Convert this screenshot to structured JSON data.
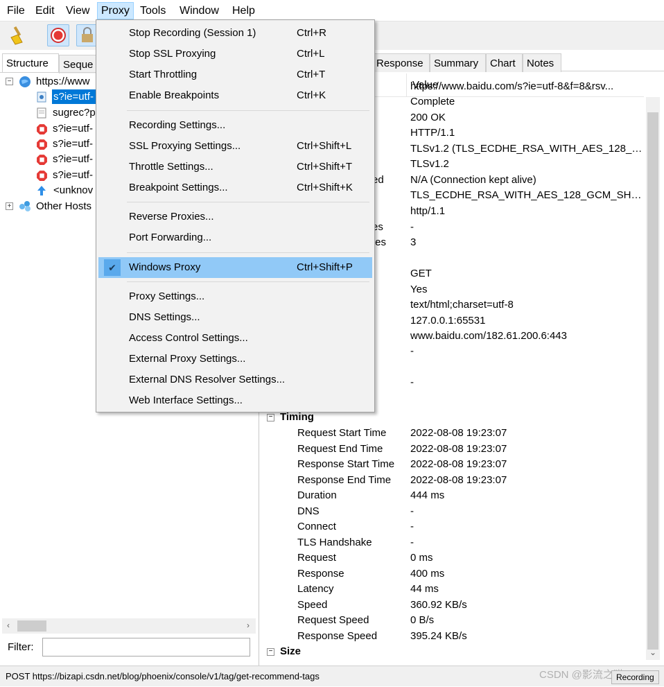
{
  "menubar": {
    "items": [
      "File",
      "Edit",
      "View",
      "Proxy",
      "Tools",
      "Window",
      "Help"
    ]
  },
  "left_tabs": [
    "Structure",
    "Seque"
  ],
  "tree": {
    "host": "https://www",
    "children": [
      "s?ie=utf-",
      "sugrec?p",
      "s?ie=utf-",
      "s?ie=utf-",
      "s?ie=utf-",
      "s?ie=utf-",
      "<unknov"
    ],
    "other_hosts": "Other Hosts"
  },
  "filter": {
    "label": "Filter:",
    "value": ""
  },
  "right_tabs": [
    "Response",
    "Summary",
    "Chart",
    "Notes"
  ],
  "column_header": "Value",
  "overview_rows": [
    {
      "key": "",
      "value": "https://www.baidu.com/s?ie=utf-8&f=8&rsv..."
    },
    {
      "key": "",
      "value": "Complete"
    },
    {
      "key": "",
      "value": "200 OK"
    },
    {
      "key": "",
      "value": "HTTP/1.1"
    },
    {
      "key": "",
      "value": "TLSv1.2 (TLS_ECDHE_RSA_WITH_AES_128_G..."
    },
    {
      "key": "",
      "value": "TLSv1.2"
    },
    {
      "key": "ed",
      "value": "N/A (Connection kept alive)"
    },
    {
      "key": "",
      "value": "TLS_ECDHE_RSA_WITH_AES_128_GCM_SHA..."
    },
    {
      "key": "",
      "value": "http/1.1"
    },
    {
      "key": "es",
      "value": "-"
    },
    {
      "key": "tes",
      "value": "3"
    },
    {
      "key": "",
      "value": ""
    },
    {
      "key": "",
      "value": "GET"
    },
    {
      "key": "",
      "value": "Yes"
    },
    {
      "key": "",
      "value": "text/html;charset=utf-8"
    },
    {
      "key": "",
      "value": "127.0.0.1:65531"
    },
    {
      "key": "",
      "value": "www.baidu.com/182.61.200.6:443"
    },
    {
      "key": "",
      "value": "-"
    },
    {
      "key": "",
      "value": ""
    },
    {
      "key": "",
      "value": "-"
    }
  ],
  "timing": {
    "title": "Timing",
    "rows": [
      {
        "key": "Request Start Time",
        "value": "2022-08-08 19:23:07"
      },
      {
        "key": "Request End Time",
        "value": "2022-08-08 19:23:07"
      },
      {
        "key": "Response Start Time",
        "value": "2022-08-08 19:23:07"
      },
      {
        "key": "Response End Time",
        "value": "2022-08-08 19:23:07"
      },
      {
        "key": "Duration",
        "value": "444 ms"
      },
      {
        "key": "DNS",
        "value": "-"
      },
      {
        "key": "Connect",
        "value": "-"
      },
      {
        "key": "TLS Handshake",
        "value": "-"
      },
      {
        "key": "Request",
        "value": "0 ms"
      },
      {
        "key": "Response",
        "value": "400 ms"
      },
      {
        "key": "Latency",
        "value": "44 ms"
      },
      {
        "key": "Speed",
        "value": "360.92 KB/s"
      },
      {
        "key": "Request Speed",
        "value": "0 B/s"
      },
      {
        "key": "Response Speed",
        "value": "395.24 KB/s"
      }
    ]
  },
  "size_section": "Size",
  "proxy_menu": [
    {
      "label": "Stop Recording (Session 1)",
      "shortcut": "Ctrl+R"
    },
    {
      "label": "Stop SSL Proxying",
      "shortcut": "Ctrl+L"
    },
    {
      "label": "Start Throttling",
      "shortcut": "Ctrl+T"
    },
    {
      "label": "Enable Breakpoints",
      "shortcut": "Ctrl+K"
    },
    {
      "label": "Recording Settings...",
      "shortcut": ""
    },
    {
      "label": "SSL Proxying Settings...",
      "shortcut": "Ctrl+Shift+L"
    },
    {
      "label": "Throttle Settings...",
      "shortcut": "Ctrl+Shift+T"
    },
    {
      "label": "Breakpoint Settings...",
      "shortcut": "Ctrl+Shift+K"
    },
    {
      "label": "Reverse Proxies...",
      "shortcut": ""
    },
    {
      "label": "Port Forwarding...",
      "shortcut": ""
    },
    {
      "label": "Windows Proxy",
      "shortcut": "Ctrl+Shift+P",
      "checked": true
    },
    {
      "label": "Proxy Settings...",
      "shortcut": ""
    },
    {
      "label": "DNS Settings...",
      "shortcut": ""
    },
    {
      "label": "Access Control Settings...",
      "shortcut": ""
    },
    {
      "label": "External Proxy Settings...",
      "shortcut": ""
    },
    {
      "label": "External DNS Resolver Settings...",
      "shortcut": ""
    },
    {
      "label": "Web Interface Settings...",
      "shortcut": ""
    }
  ],
  "status": {
    "text": "POST https://bizapi.csdn.net/blog/phoenix/console/v1/tag/get-recommend-tags",
    "recording": "Recording",
    "watermark": "CSDN @影流之猫"
  },
  "colors": {
    "highlight": "#91c9f7",
    "selection": "#0078d7",
    "menu_active": "#cce8ff"
  }
}
